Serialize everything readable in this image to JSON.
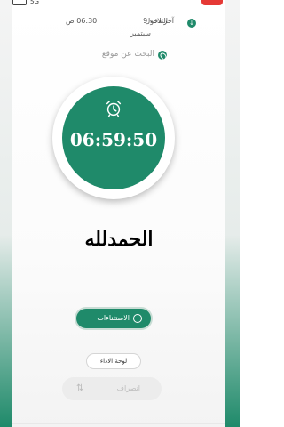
{
  "status_bar": {
    "network": "5G"
  },
  "info": {
    "last_login_label": "آخر دخول",
    "day_date": "الثلاثاء 9",
    "month": "سبتمبر",
    "time": "06:30 ص"
  },
  "search": {
    "label": "البحث عن موقع"
  },
  "clock": {
    "time": "06:59:50"
  },
  "greeting": {
    "text": "الحمدلله"
  },
  "buttons": {
    "exceptions": "الاستثناءات",
    "performance_board": "لوحة الاداء",
    "leave": "انصراف"
  },
  "icons": {
    "info": "info-icon",
    "location": "location-leaf-icon",
    "alarm": "alarm-clock-icon",
    "exceptions": "clock-icon",
    "leave": "swap-arrows-icon"
  },
  "colors": {
    "accent": "#1f8a6a",
    "status_red": "#e53935"
  }
}
